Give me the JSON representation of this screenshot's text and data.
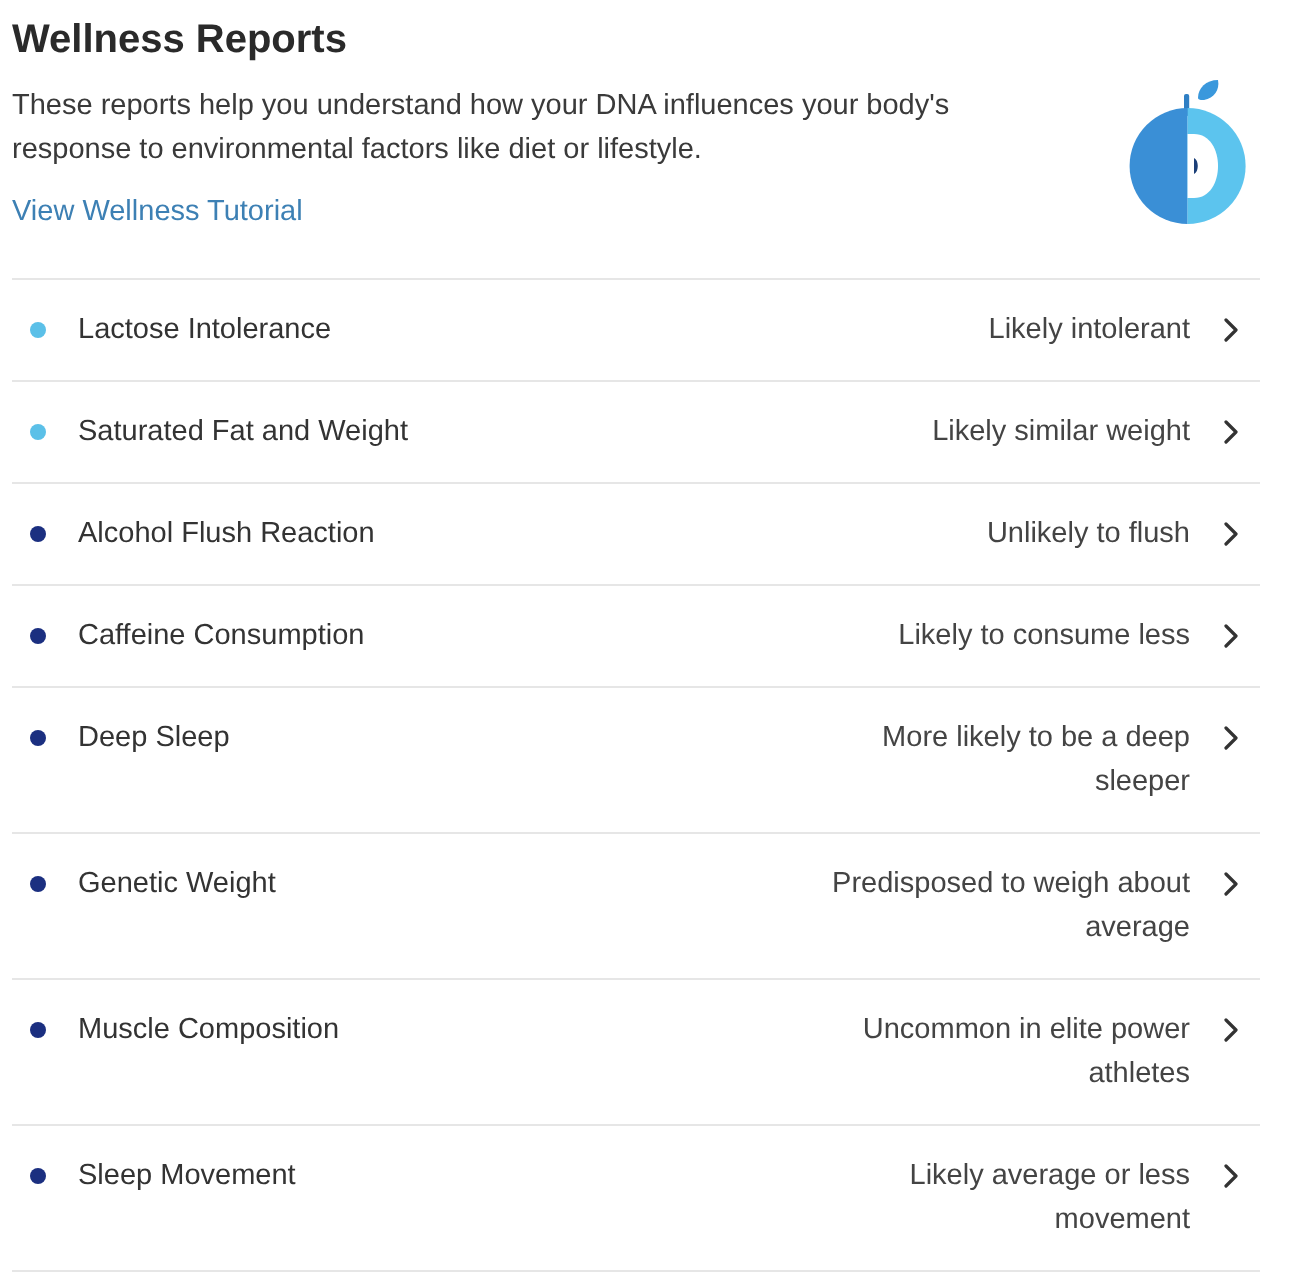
{
  "header": {
    "title": "Wellness Reports",
    "description": "These reports help you understand how your DNA influences your body's response to environmental factors like diet or lifestyle.",
    "link": "View Wellness Tutorial"
  },
  "reports": [
    {
      "name": "Lactose Intolerance",
      "result": "Likely intolerant",
      "color": "#5bc0e8"
    },
    {
      "name": "Saturated Fat and Weight",
      "result": "Likely similar weight",
      "color": "#5bc0e8"
    },
    {
      "name": "Alcohol Flush Reaction",
      "result": "Unlikely to flush",
      "color": "#1b2f80"
    },
    {
      "name": "Caffeine Consumption",
      "result": "Likely to consume less",
      "color": "#1b2f80"
    },
    {
      "name": "Deep Sleep",
      "result": "More likely to be a deep sleeper",
      "color": "#1b2f80"
    },
    {
      "name": "Genetic Weight",
      "result": "Predisposed to weigh about average",
      "color": "#1b2f80"
    },
    {
      "name": "Muscle Composition",
      "result": "Uncommon in elite power athletes",
      "color": "#1b2f80"
    },
    {
      "name": "Sleep Movement",
      "result": "Likely average or less movement",
      "color": "#1b2f80"
    }
  ]
}
